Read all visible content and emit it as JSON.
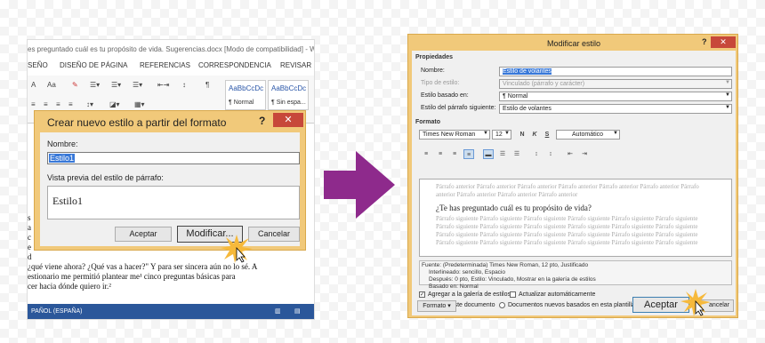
{
  "left_window": {
    "title": "es preguntado cuál es tu propósito de vida. Sugerencias.docx [Modo de compatibilidad] - Wo",
    "tabs": [
      "SEÑO",
      "DISEÑO DE PÁGINA",
      "REFERENCIAS",
      "CORRESPONDENCIA",
      "REVISAR"
    ],
    "ribbon": {
      "font_grow": "A",
      "case": "Aa",
      "pilcrow": "¶"
    },
    "styles": [
      {
        "preview": "AaBbCcDc",
        "label": "¶ Normal"
      },
      {
        "preview": "AaBbCcDc",
        "label": "¶ Sin espa..."
      }
    ],
    "doc_lines": [
      "s",
      "a",
      "c",
      "e",
      "d",
      "¿qué viene ahora? ¿Qué vas a hacer?\" Y para ser sincera aún no lo sé. A",
      "estionario me permitió plantear me¹ cinco preguntas básicas para",
      "cer hacia dónde quiero ir.²"
    ],
    "status": "PAÑOL (ESPAÑA)"
  },
  "left_dialog": {
    "title": "Crear nuevo estilo a partir del formato",
    "help": "?",
    "close": "✕",
    "name_label": "Nombre:",
    "name_value": "Estilo1",
    "preview_label": "Vista previa del estilo de párrafo:",
    "preview_text": "Estilo1",
    "ok": "Aceptar",
    "modify": "Modificar...",
    "cancel": "Cancelar"
  },
  "right_dialog": {
    "title": "Modificar estilo",
    "help": "?",
    "close": "✕",
    "props_label": "Propiedades",
    "name_label": "Nombre:",
    "name_value": "Estilo de volantes",
    "type_label": "Tipo de estilo:",
    "type_value": "Vinculado (párrafo y carácter)",
    "based_label": "Estilo basado en:",
    "based_value": "¶ Normal",
    "next_label": "Estilo del párrafo siguiente:",
    "next_value": "Estilo de volantes",
    "format_label": "Formato",
    "font": "Times New Roman",
    "size": "12",
    "bold": "N",
    "italic": "K",
    "underline": "S",
    "color": "Automático",
    "preview_prev": "Párrafo anterior Párrafo anterior Párrafo anterior Párrafo anterior Párrafo anterior Párrafo anterior Párrafo anterior Párrafo anterior Párrafo anterior Párrafo anterior",
    "preview_main": "¿Te has preguntado cuál es tu propósito de vida?",
    "preview_next": "Párrafo siguiente Párrafo siguiente Párrafo siguiente Párrafo siguiente Párrafo siguiente Párrafo siguiente Párrafo siguiente Párrafo siguiente Párrafo siguiente Párrafo siguiente Párrafo siguiente Párrafo siguiente Párrafo siguiente Párrafo siguiente Párrafo siguiente Párrafo siguiente Párrafo siguiente Párrafo siguiente Párrafo siguiente Párrafo siguiente Párrafo siguiente Párrafo siguiente Párrafo siguiente Párrafo siguiente",
    "description": [
      "Fuente: (Predeterminada) Times New Roman, 12 pto, Justificado",
      "Interlineado:  sencillo, Espacio",
      "Después:  0 pto, Estilo: Vinculado, Mostrar en la galería de estilos",
      "Basado en: Normal"
    ],
    "add_gallery": "Agregar a la galería de estilos",
    "auto_update": "Actualizar automáticamente",
    "only_doc": "Solo en este documento",
    "new_docs": "Documentos nuevos basados en esta plantilla",
    "format_btn": "Formato ▾",
    "ok": "Aceptar",
    "cancel": "ancelar"
  },
  "colors": {
    "arrow": "#8e2a8c",
    "dialog_frame": "#f1c97a",
    "close": "#c7483a",
    "accent": "#2b579a"
  }
}
